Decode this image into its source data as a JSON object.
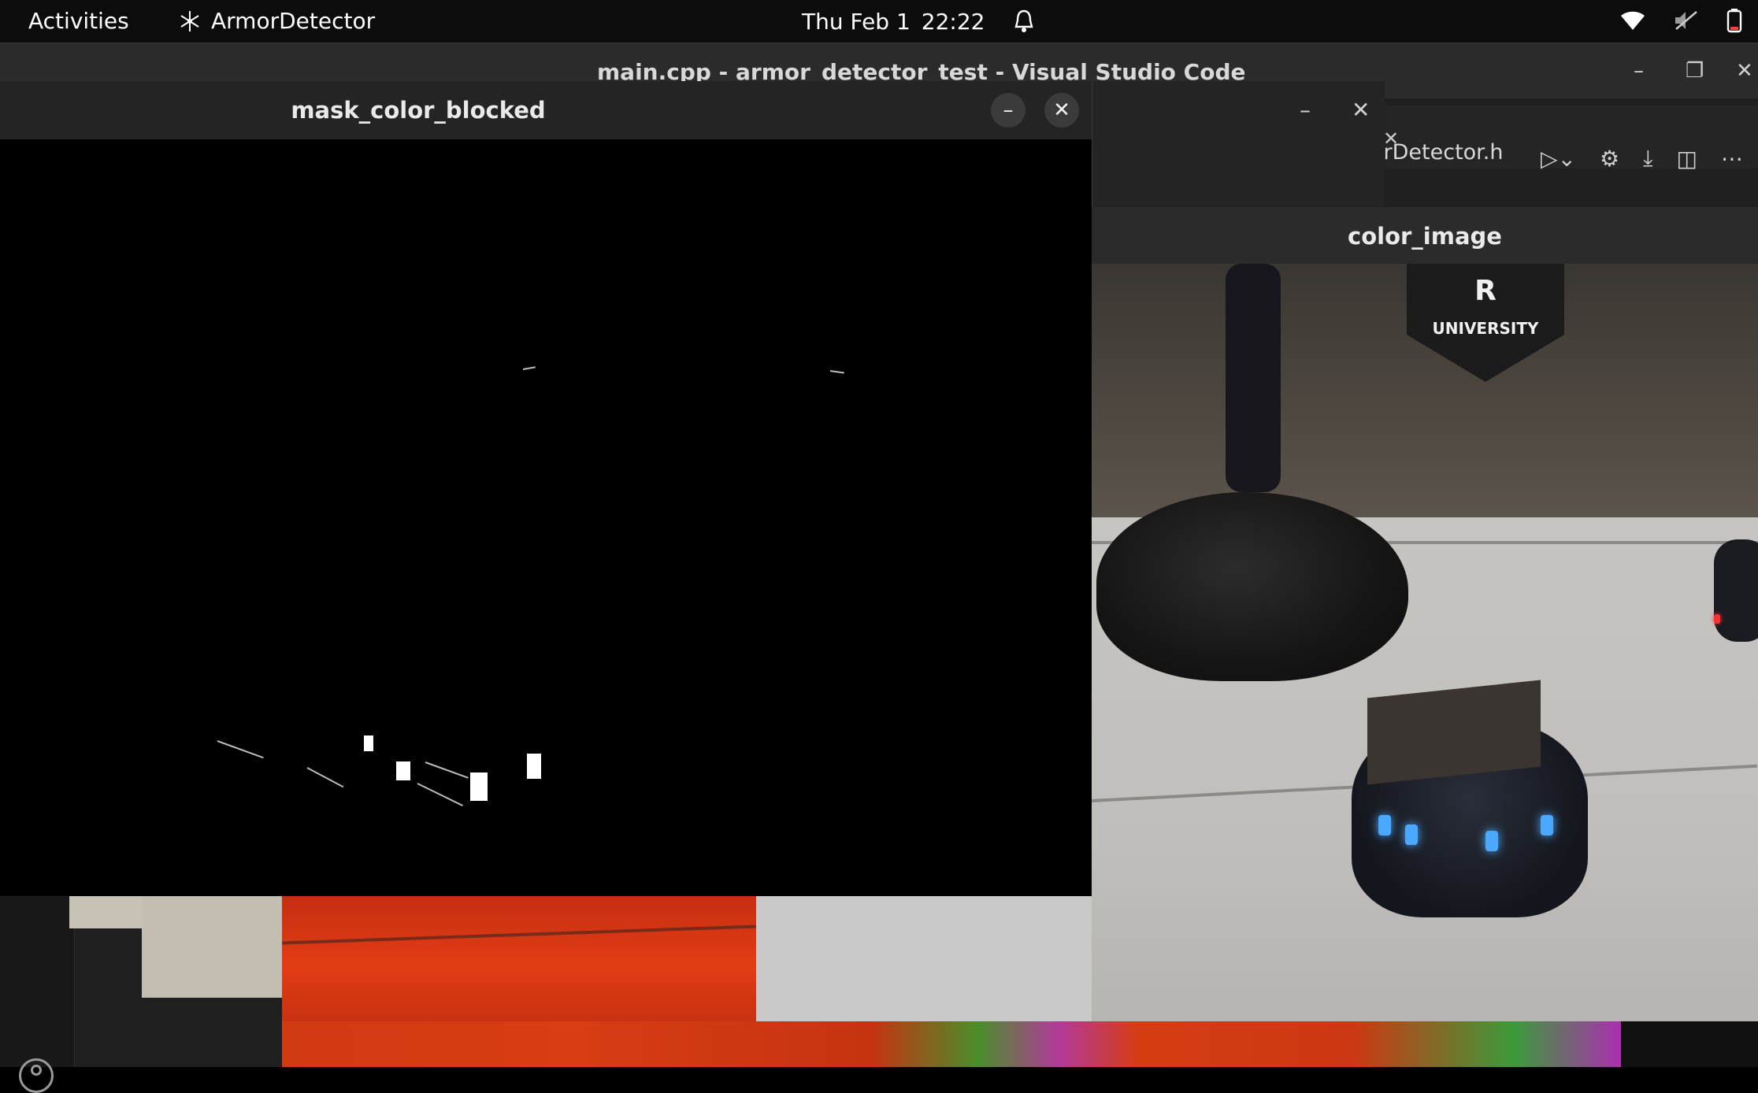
{
  "topbar": {
    "activities": "Activities",
    "app_name": "ArmorDetector",
    "date": "Thu Feb 1",
    "time": "22:22"
  },
  "vscode": {
    "window_title": "main.cpp - armor_detector_test - Visual Studio Code",
    "tab_fragment": "orDetector.h"
  },
  "mask_window": {
    "title": "mask_color_blocked"
  },
  "color_window": {
    "title": "color_image",
    "banner_letter": "R",
    "banner_text": "UNIVERSITY"
  },
  "colors": {
    "topbar_bg": "#0c0c0c",
    "window_header": "#242424",
    "vscode_bg": "#1f1f1f"
  }
}
